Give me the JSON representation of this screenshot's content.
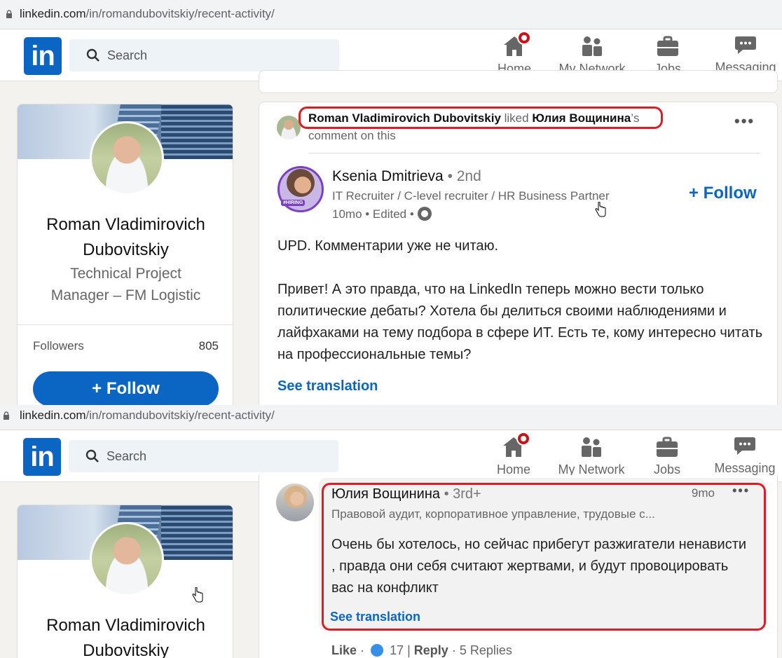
{
  "browser": {
    "url_host": "linkedin.com",
    "url_path": "/in/romandubovitskiy/recent-activity/"
  },
  "nav": {
    "logo": "in",
    "search_placeholder": "Search",
    "items": [
      {
        "label": "Home",
        "icon": "home-icon"
      },
      {
        "label": "My Network",
        "icon": "my-network-icon"
      },
      {
        "label": "Jobs",
        "icon": "jobs-icon"
      },
      {
        "label": "Messaging",
        "icon": "messaging-icon"
      }
    ]
  },
  "profile": {
    "name_line1": "Roman Vladimirovich",
    "name_line2": "Dubovitskiy",
    "title_line1": "Technical Project",
    "title_line2": "Manager – FM Logistic",
    "followers_label": "Followers",
    "followers_count": "805",
    "follow_button": "+ Follow"
  },
  "activity": {
    "actor": "Roman Vladimirovich Dubovitskiy",
    "verb": " liked ",
    "target": "Юлия Вощинина",
    "suffix": "’s",
    "line2": "comment on this",
    "more": "•••"
  },
  "post": {
    "author_name": "Ksenia Dmitrieva",
    "author_degree": " • 2nd",
    "author_headline": "IT Recruiter / C-level recruiter / HR Business Partner",
    "meta": "10mo • Edited • ",
    "avatar_badge": "#HIRING",
    "follow_label": "+ Follow",
    "paragraph1": "UPD. Комментарии уже не читаю.",
    "paragraph2": "Привет! А это правда, что на LinkedIn теперь можно вести только политические дебаты? Хотела бы делиться своими наблюдениями и лайфхаками на тему подбора в сфере ИТ. Есть те, кому интересно читать на профессиональные темы?",
    "see_translation": "See translation"
  },
  "comment": {
    "author_name": "Юлия Вощинина",
    "author_degree": " • 3rd+",
    "headline": "Правовой аудит, корпоративное управление, трудовые с...",
    "time": "9mo",
    "more": "•••",
    "text": "Очень бы хотелось, но сейчас прибегут разжигатели ненависти , правда они себя считают жертвами, и будут провоцировать вас на конфликт",
    "see_translation": "See translation",
    "like_label": "Like",
    "reactions": "17",
    "reply_label": "Reply",
    "replies": "5 Replies"
  },
  "colors": {
    "brand": "#0a66c2",
    "highlight": "#e01b24",
    "notification": "#cc1016"
  }
}
